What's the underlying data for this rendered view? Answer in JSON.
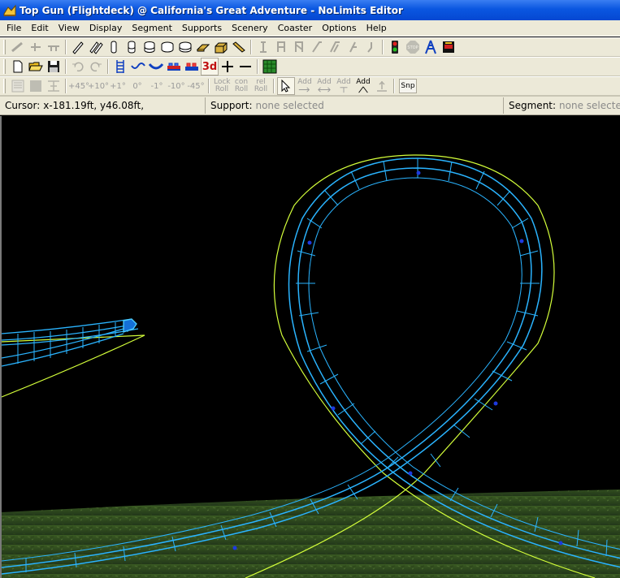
{
  "window": {
    "title": "Top Gun (Flightdeck) @ California's Great Adventure - NoLimits Editor"
  },
  "menu": {
    "items": [
      "File",
      "Edit",
      "View",
      "Display",
      "Segment",
      "Supports",
      "Scenery",
      "Coaster",
      "Options",
      "Help"
    ]
  },
  "toolbar3": {
    "pitch_labels": [
      "+45°",
      "+10°",
      "+1°",
      "0°",
      "-1°",
      "-10°",
      "-45°"
    ],
    "lock_roll": "Lock Roll",
    "con_roll": "con Roll",
    "rel_roll": "rel Roll",
    "add_labels": [
      "Add",
      "Add",
      "Add",
      "Add"
    ],
    "snap_label": "Snp"
  },
  "toolbar2": {
    "view_3d_label": "3d"
  },
  "status": {
    "cursor_key": "Cursor:",
    "cursor_value": "x-181.19ft, y46.08ft,",
    "support_key": "Support:",
    "support_value": "none selected",
    "segment_key": "Segment:",
    "segment_value": "none selected"
  },
  "colors": {
    "track": "#2ab4ff",
    "track_dark": "#1470d8",
    "guide_curve": "#d4ff3a",
    "ground": "#2f4a1c",
    "sky": "#000000"
  }
}
